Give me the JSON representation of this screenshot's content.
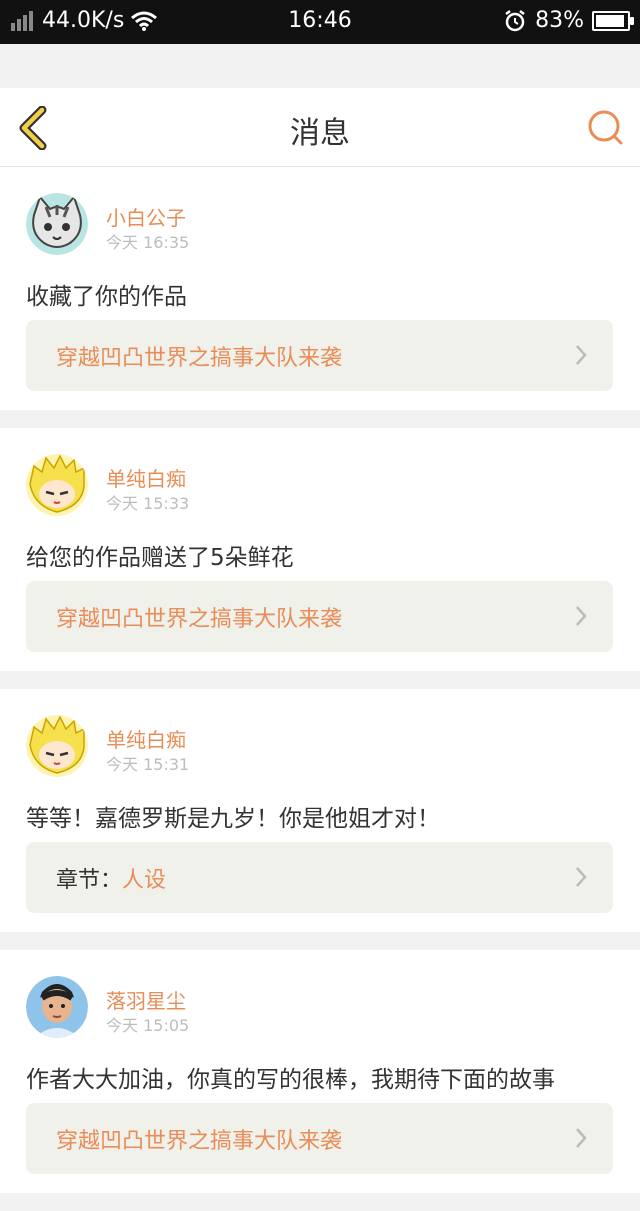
{
  "statusbar": {
    "speed": "44.0K/s",
    "time": "16:46",
    "battery": "83%"
  },
  "header": {
    "title": "消息"
  },
  "messages": [
    {
      "name": "小白公子",
      "time": "今天 16:35",
      "text": "收藏了你的作品",
      "link_prefix": "",
      "link": "穿越凹凸世界之搞事大队来袭",
      "avatar": "cat"
    },
    {
      "name": "单纯白痴",
      "time": "今天 15:33",
      "text": "给您的作品赠送了5朵鲜花",
      "link_prefix": "",
      "link": "穿越凹凸世界之搞事大队来袭",
      "avatar": "anime"
    },
    {
      "name": "单纯白痴",
      "time": "今天 15:31",
      "text": "等等！嘉德罗斯是九岁！你是他姐才对！",
      "link_prefix": "章节：",
      "link": "人设",
      "avatar": "anime"
    },
    {
      "name": "落羽星尘",
      "time": "今天 15:05",
      "text": "作者大大加油，你真的写的很棒，我期待下面的故事",
      "link_prefix": "",
      "link": "穿越凹凸世界之搞事大队来袭",
      "avatar": "person"
    }
  ],
  "colors": {
    "accent": "#e98d57",
    "back_icon": "#e8c230"
  }
}
